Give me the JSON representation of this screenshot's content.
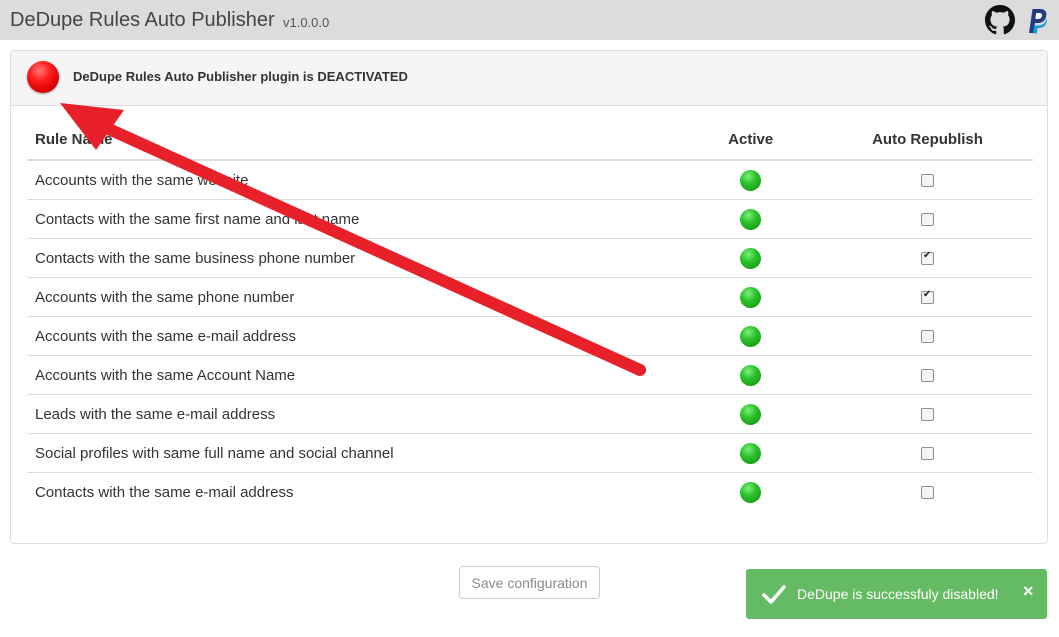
{
  "header": {
    "title": "DeDupe Rules Auto Publisher",
    "version": "v1.0.0.0",
    "icons": [
      "github-icon",
      "paypal-icon"
    ]
  },
  "status": {
    "message": "DeDupe Rules Auto Publisher plugin is DEACTIVATED",
    "state": "deactivated",
    "color": "#e00000"
  },
  "table": {
    "headers": {
      "name": "Rule Name",
      "active": "Active",
      "auto_republish": "Auto Republish"
    },
    "rows": [
      {
        "name": "Accounts with the same website",
        "active": true,
        "auto_republish": false
      },
      {
        "name": "Contacts with the same first name and last name",
        "active": true,
        "auto_republish": false
      },
      {
        "name": "Contacts with the same business phone number",
        "active": true,
        "auto_republish": true
      },
      {
        "name": "Accounts with the same phone number",
        "active": true,
        "auto_republish": true
      },
      {
        "name": "Accounts with the same e-mail address",
        "active": true,
        "auto_republish": false
      },
      {
        "name": "Accounts with the same Account Name",
        "active": true,
        "auto_republish": false
      },
      {
        "name": "Leads with the same e-mail address",
        "active": true,
        "auto_republish": false
      },
      {
        "name": "Social profiles with same full name and social channel",
        "active": true,
        "auto_republish": false
      },
      {
        "name": "Contacts with the same e-mail address",
        "active": true,
        "auto_republish": false
      }
    ]
  },
  "actions": {
    "save_label": "Save configuration"
  },
  "toast": {
    "message": "DeDupe is successfuly disabled!",
    "close": "×",
    "color": "#5cb85c"
  },
  "annotation": {
    "type": "arrow",
    "color": "#e8202a"
  }
}
